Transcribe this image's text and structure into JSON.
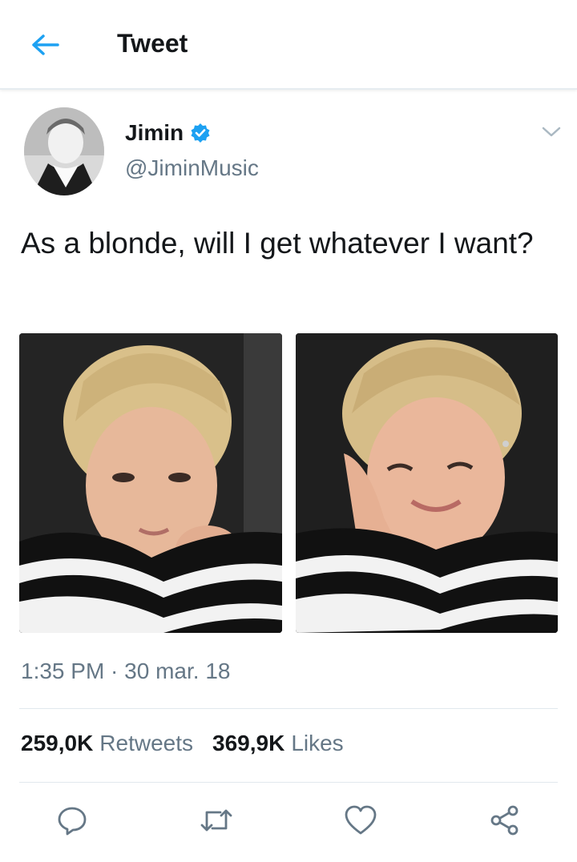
{
  "header": {
    "title": "Tweet",
    "back_icon": "back-arrow-icon",
    "accent_color": "#1da1f2"
  },
  "author": {
    "name": "Jimin",
    "handle": "@JiminMusic",
    "verified": true
  },
  "tweet": {
    "text": "As a blonde, will I get whatever I want?",
    "timestamp": "1:35 PM · 30 mar. 18"
  },
  "stats": {
    "retweets_count": "259,0K",
    "retweets_label": "Retweets",
    "likes_count": "369,9K",
    "likes_label": "Likes"
  },
  "actions": {
    "reply_icon": "reply-icon",
    "retweet_icon": "retweet-icon",
    "like_icon": "heart-icon",
    "share_icon": "share-icon"
  },
  "colors": {
    "text_primary": "#14171a",
    "text_secondary": "#657786",
    "divider": "#e1e8ed",
    "verified_badge": "#1da1f2"
  }
}
